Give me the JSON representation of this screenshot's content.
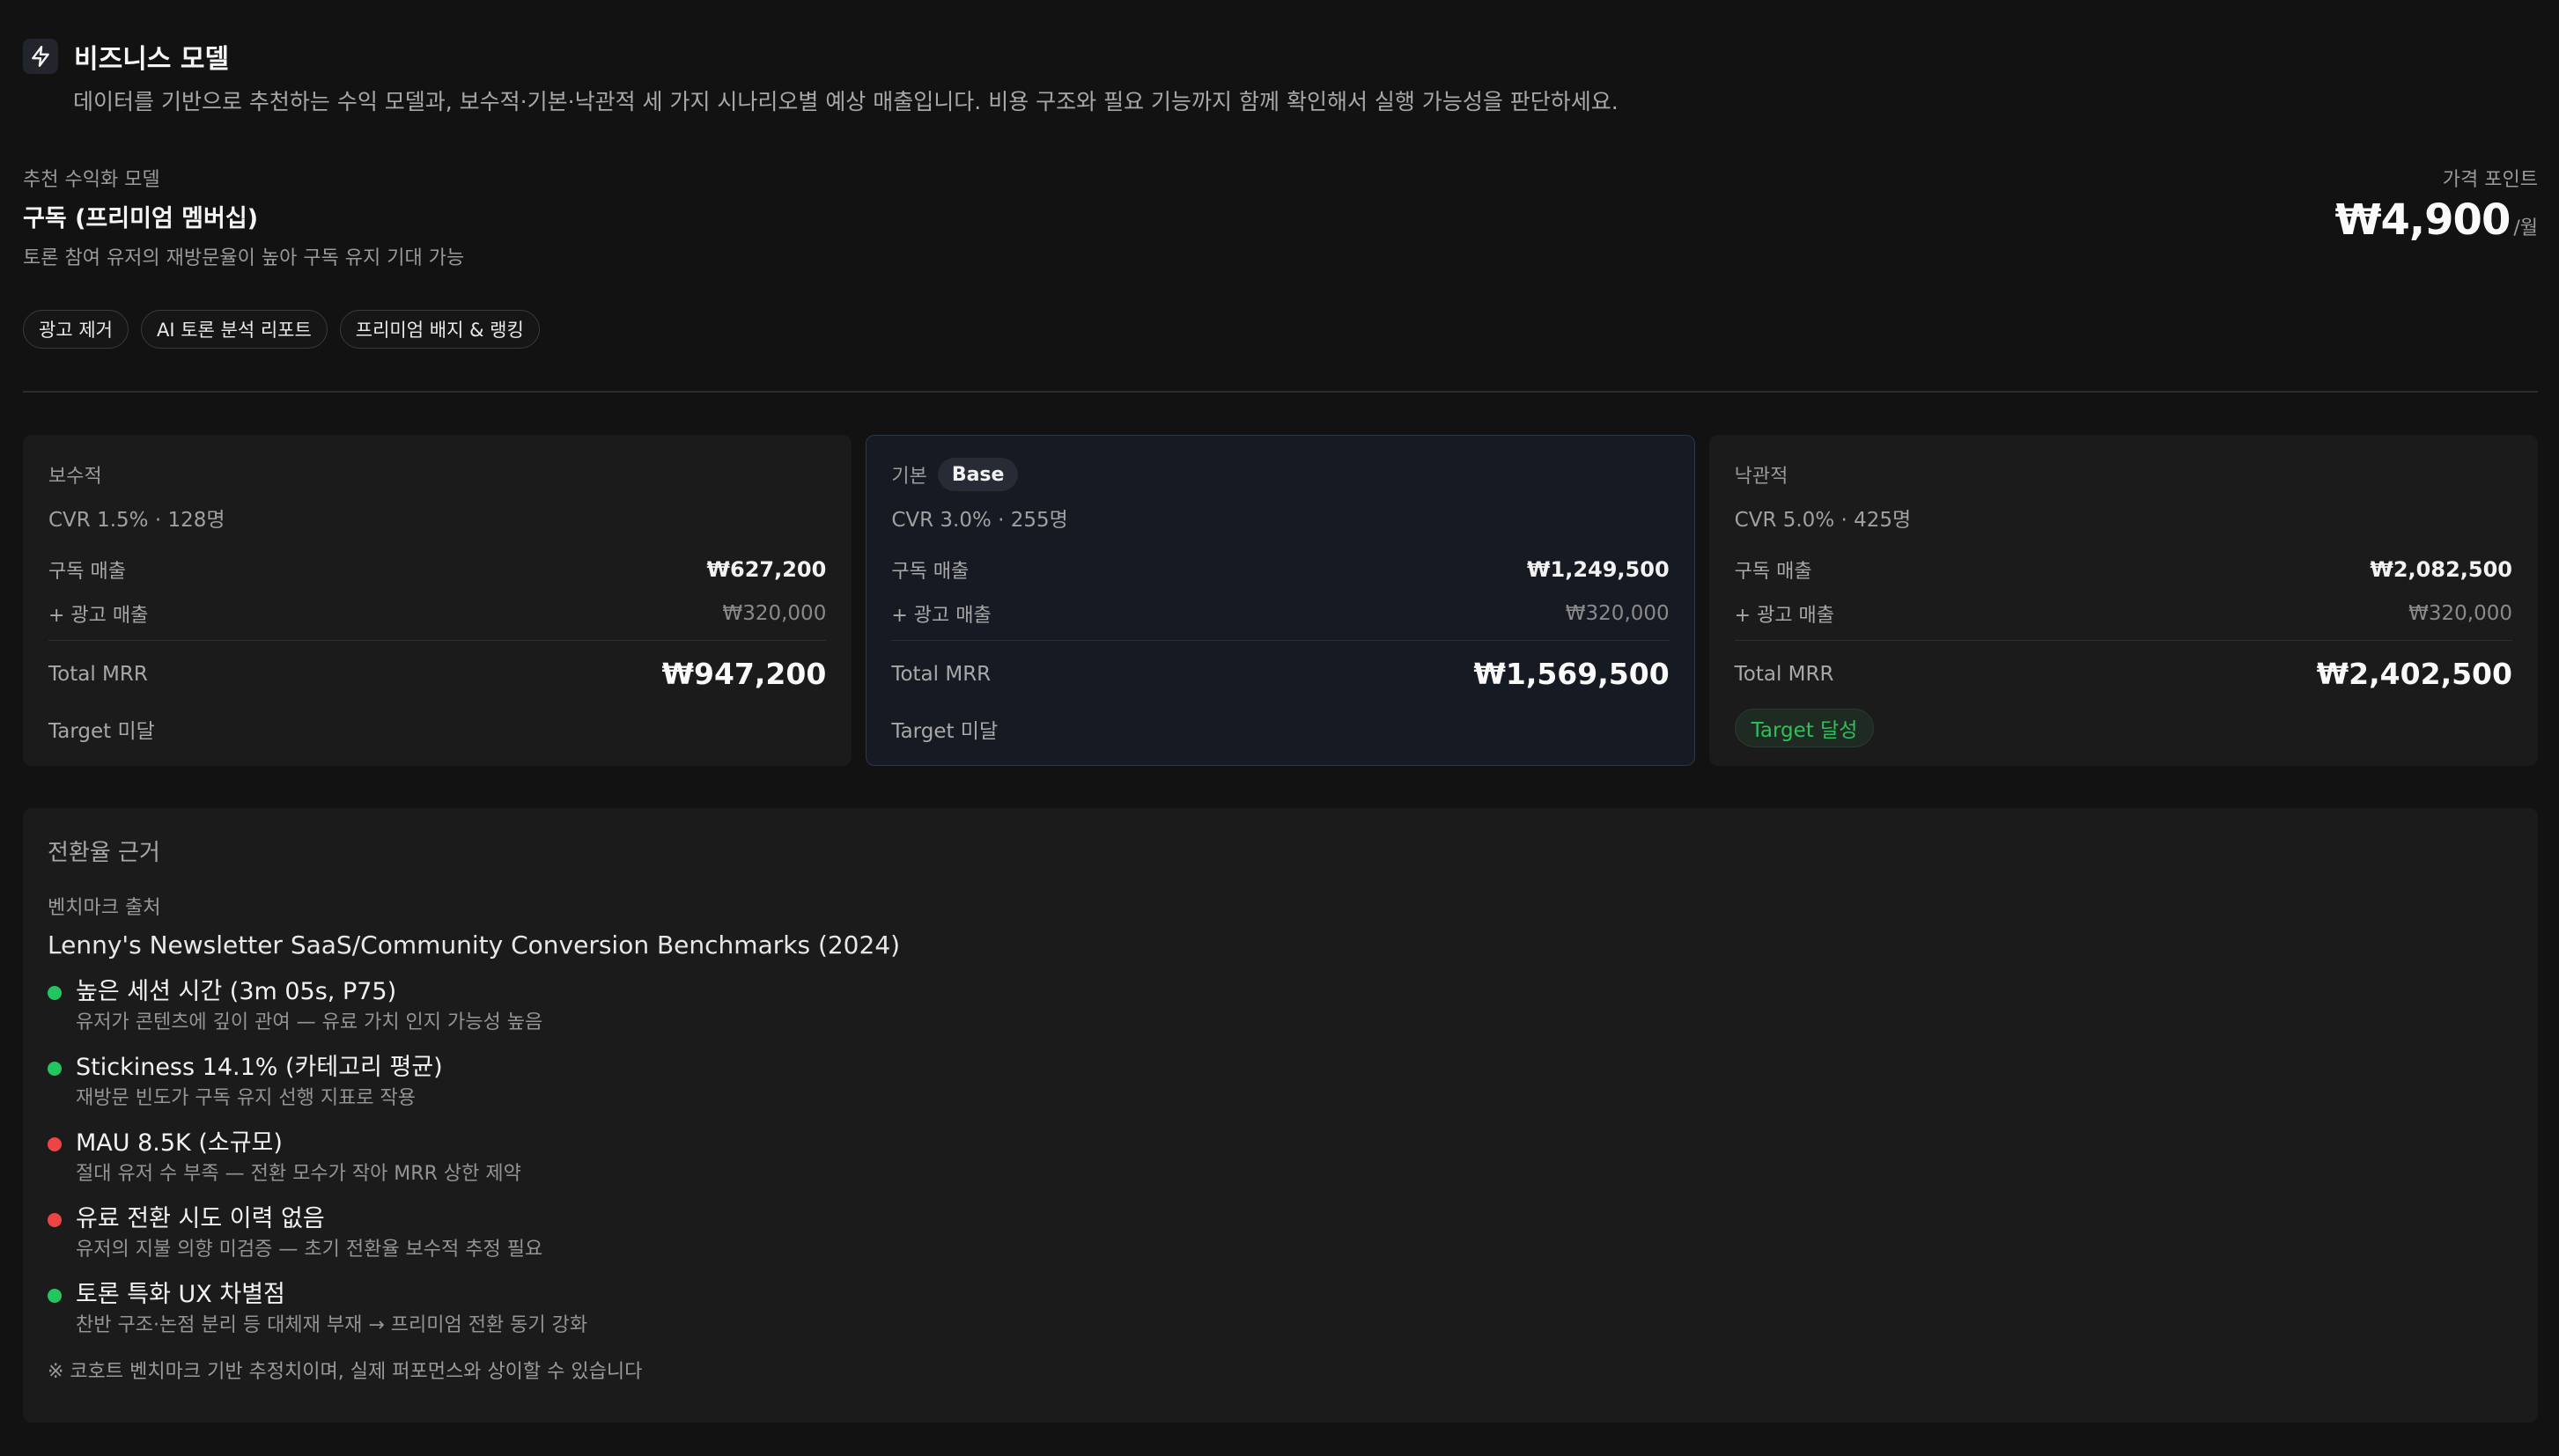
{
  "header": {
    "title": "비즈니스 모델",
    "description": "데이터를 기반으로 추천하는 수익 모델과, 보수적·기본·낙관적 세 가지 시나리오별 예상 매출입니다. 비용 구조와 필요 기능까지 함께 확인해서 실행 가능성을 판단하세요.",
    "icon": "lightning-icon"
  },
  "recommendation": {
    "label": "추천 수익화 모델",
    "name": "구독 (프리미엄 멤버십)",
    "reason": "토론 참여 유저의 재방문율이 높아 구독 유지 기대 가능",
    "price_label": "가격 포인트",
    "price": "₩4,900",
    "price_unit": "/월",
    "features": [
      "광고 제거",
      "AI 토론 분석 리포트",
      "프리미엄 배지 & 랭킹"
    ]
  },
  "scenarios": [
    {
      "label": "보수적",
      "badge": "",
      "cvr": "CVR 1.5% · 128명",
      "sub_label": "구독 매출",
      "sub_value": "₩627,200",
      "ad_label": "+ 광고 매출",
      "ad_value": "₩320,000",
      "total_label": "Total MRR",
      "total_value": "₩947,200",
      "target": "Target 미달",
      "target_met": false
    },
    {
      "label": "기본",
      "badge": "Base",
      "cvr": "CVR 3.0% · 255명",
      "sub_label": "구독 매출",
      "sub_value": "₩1,249,500",
      "ad_label": "+ 광고 매출",
      "ad_value": "₩320,000",
      "total_label": "Total MRR",
      "total_value": "₩1,569,500",
      "target": "Target 미달",
      "target_met": false
    },
    {
      "label": "낙관적",
      "badge": "",
      "cvr": "CVR 5.0% · 425명",
      "sub_label": "구독 매출",
      "sub_value": "₩2,082,500",
      "ad_label": "+ 광고 매출",
      "ad_value": "₩320,000",
      "total_label": "Total MRR",
      "total_value": "₩2,402,500",
      "target": "Target 달성",
      "target_met": true
    }
  ],
  "basis": {
    "title": "전환율 근거",
    "bench_label": "벤치마크 출처",
    "bench_source": "Lenny's Newsletter SaaS/Community Conversion Benchmarks (2024)",
    "factors": [
      {
        "title": "높은 세션 시간 (3m 05s, P75)",
        "desc": "유저가 콘텐츠에 깊이 관여 — 유료 가치 인지 가능성 높음",
        "status": "positive"
      },
      {
        "title": "Stickiness 14.1% (카테고리 평균)",
        "desc": "재방문 빈도가 구독 유지 선행 지표로 작용",
        "status": "positive"
      },
      {
        "title": "MAU 8.5K (소규모)",
        "desc": "절대 유저 수 부족 — 전환 모수가 작아 MRR 상한 제약",
        "status": "negative"
      },
      {
        "title": "유료 전환 시도 이력 없음",
        "desc": "유저의 지불 의향 미검증 — 초기 전환율 보수적 추정 필요",
        "status": "negative"
      },
      {
        "title": "토론 특화 UX 차별점",
        "desc": "찬반 구조·논점 분리 등 대체재 부재 → 프리미엄 전환 동기 강화",
        "status": "positive"
      }
    ],
    "disclaimer": "※ 코호트 벤치마크 기반 추정치이며, 실제 퍼포먼스와 상이할 수 있습니다"
  },
  "colors": {
    "positive": "#22c55e",
    "negative": "#ef4444",
    "target_met": "#2fbf5b"
  }
}
